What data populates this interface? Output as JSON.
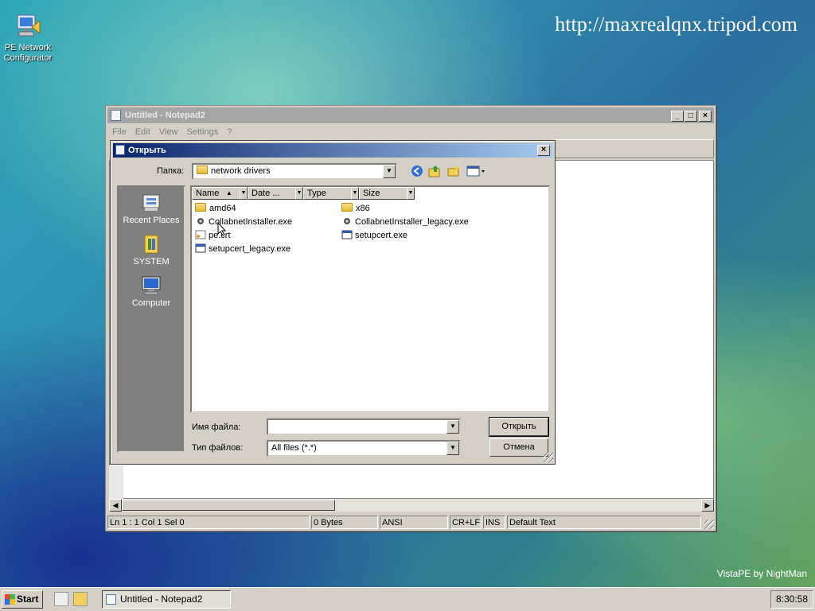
{
  "desktop": {
    "icon_label": "PE Network\nConfigurator",
    "url_text": "http://maxrealqnx.tripod.com",
    "brand_text": "VistaPE by NightMan"
  },
  "notepad": {
    "title": "Untitled - Notepad2",
    "menu": [
      "File",
      "Edit",
      "View",
      "Settings",
      "?"
    ],
    "status": {
      "position": "Ln 1 : 1   Col 1   Sel 0",
      "size": "0 Bytes",
      "encoding": "ANSI",
      "line_endings": "CR+LF",
      "ins": "INS",
      "scheme": "Default Text"
    }
  },
  "dialog": {
    "title": "Открыть",
    "look_in_label": "Папка:",
    "look_in_value": "network drivers",
    "places": [
      "Recent Places",
      "SYSTEM",
      "Computer"
    ],
    "columns": [
      "Name",
      "Date ...",
      "Type",
      "Size"
    ],
    "files": [
      {
        "name": "amd64",
        "icon": "folder-icon"
      },
      {
        "name": "x86",
        "icon": "folder-icon"
      },
      {
        "name": "CollabnetInstaller.exe",
        "icon": "exe-icon"
      },
      {
        "name": "CollabnetInstaller_legacy.exe",
        "icon": "exe-icon"
      },
      {
        "name": "pe.crt",
        "icon": "cert-icon"
      },
      {
        "name": "setupcert.exe",
        "icon": "app-icon"
      },
      {
        "name": "setupcert_legacy.exe",
        "icon": "app-icon"
      }
    ],
    "filename_label": "Имя файла:",
    "filename_value": "",
    "filetype_label": "Тип файлов:",
    "filetype_value": "All files (*.*)",
    "open_button": "Открыть",
    "cancel_button": "Отмена"
  },
  "taskbar": {
    "start_label": "Start",
    "task_label": "Untitled - Notepad2",
    "clock": "8:30:58"
  }
}
